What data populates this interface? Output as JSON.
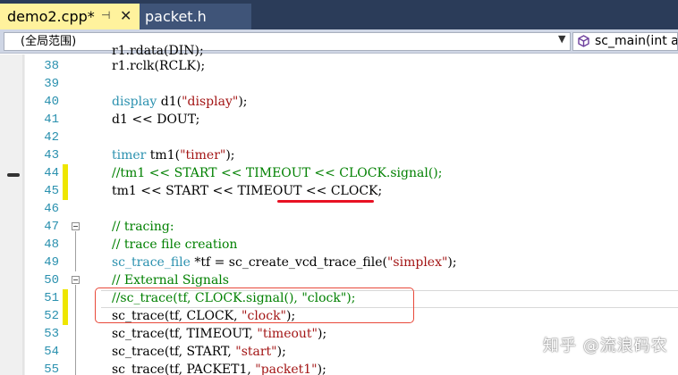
{
  "tabs": [
    {
      "label": "demo2.cpp*",
      "active": true
    },
    {
      "label": "packet.h",
      "active": false
    }
  ],
  "tab_pin_glyph": "⊣",
  "tab_close_glyph": "✕",
  "navbar": {
    "scope": "(全局范围)",
    "member": "sc_main(int a"
  },
  "editor": {
    "lines": [
      {
        "num": "38",
        "text": "r1.rclk(RCLK);"
      },
      {
        "num": "39",
        "text": ""
      },
      {
        "num": "40",
        "text": "display d1(\"display\");"
      },
      {
        "num": "41",
        "text": "d1 << DOUT;"
      },
      {
        "num": "42",
        "text": ""
      },
      {
        "num": "43",
        "text": "timer tm1(\"timer\");"
      },
      {
        "num": "44",
        "text": "//tm1 << START << TIMEOUT << CLOCK.signal();"
      },
      {
        "num": "45",
        "text": "tm1 << START << TIMEOUT << CLOCK;"
      },
      {
        "num": "46",
        "text": ""
      },
      {
        "num": "47",
        "text": "// tracing:"
      },
      {
        "num": "48",
        "text": "// trace file creation"
      },
      {
        "num": "49",
        "text": "sc_trace_file *tf = sc_create_vcd_trace_file(\"simplex\");"
      },
      {
        "num": "50",
        "text": "// External Signals"
      },
      {
        "num": "51",
        "text": "//sc_trace(tf, CLOCK.signal(), \"clock\");"
      },
      {
        "num": "52",
        "text": "sc_trace(tf, CLOCK, \"clock\");"
      },
      {
        "num": "53",
        "text": "sc_trace(tf, TIMEOUT, \"timeout\");"
      },
      {
        "num": "54",
        "text": "sc_trace(tf, START, \"start\");"
      },
      {
        "num": "55",
        "text": "sc_trace(tf, PACKET1, \"packet1\");"
      }
    ]
  },
  "watermark": "知乎 @流浪码农",
  "colors": {
    "keyword": "#2b91af",
    "comment": "#008000",
    "string": "#a31515",
    "change_bar": "#eee600",
    "annotation_red": "#e81123",
    "tab_active": "#fff29d"
  }
}
